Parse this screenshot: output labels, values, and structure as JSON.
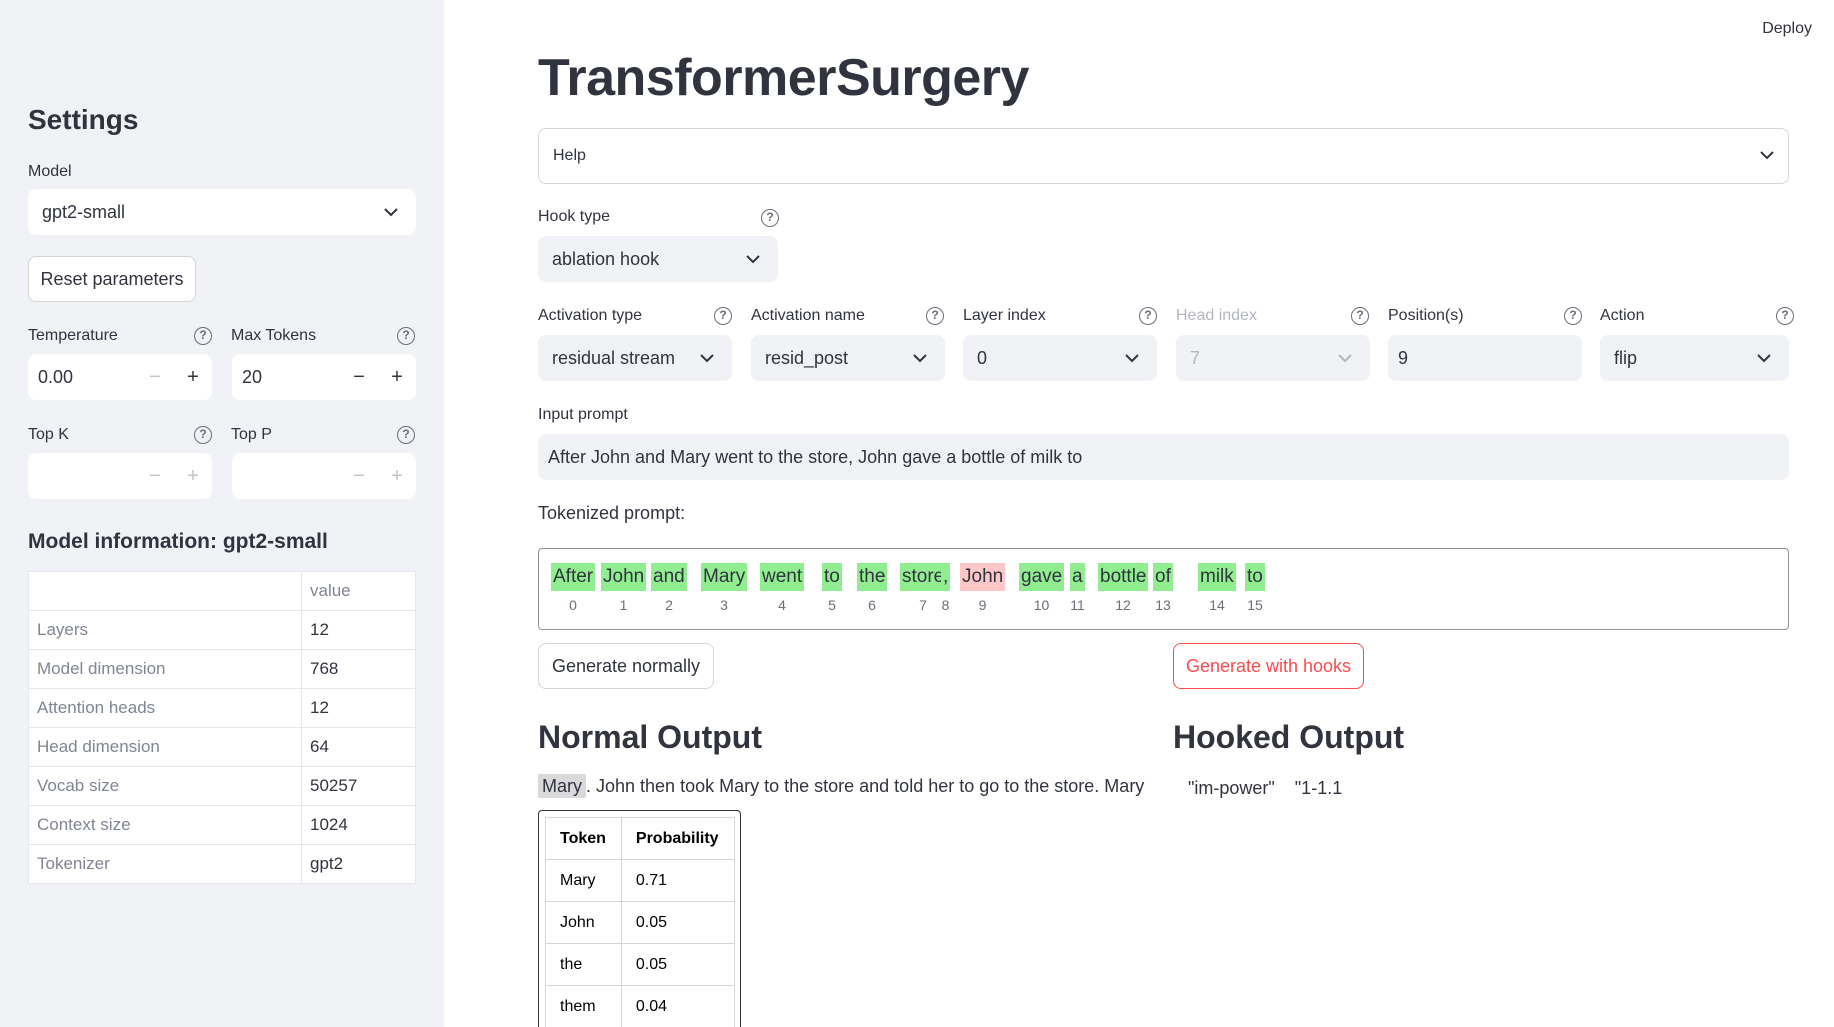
{
  "deploy_label": "Deploy",
  "sidebar": {
    "title": "Settings",
    "model_label": "Model",
    "model_value": "gpt2-small",
    "reset_label": "Reset parameters",
    "temperature": {
      "label": "Temperature",
      "value": "0.00"
    },
    "max_tokens": {
      "label": "Max Tokens",
      "value": "20"
    },
    "top_k": {
      "label": "Top K",
      "value": ""
    },
    "top_p": {
      "label": "Top P",
      "value": ""
    },
    "info_title": "Model information: gpt2-small",
    "info_header": [
      "",
      "value"
    ],
    "info_rows": [
      {
        "k": "Layers",
        "v": "12"
      },
      {
        "k": "Model dimension",
        "v": "768"
      },
      {
        "k": "Attention heads",
        "v": "12"
      },
      {
        "k": "Head dimension",
        "v": "64"
      },
      {
        "k": "Vocab size",
        "v": "50257"
      },
      {
        "k": "Context size",
        "v": "1024"
      },
      {
        "k": "Tokenizer",
        "v": "gpt2"
      }
    ]
  },
  "main": {
    "title": "TransformerSurgery",
    "help_label": "Help",
    "hook_type": {
      "label": "Hook type",
      "value": "ablation hook"
    },
    "activation_type": {
      "label": "Activation type",
      "value": "residual stream"
    },
    "activation_name": {
      "label": "Activation name",
      "value": "resid_post"
    },
    "layer_index": {
      "label": "Layer index",
      "value": "0"
    },
    "head_index": {
      "label": "Head index",
      "value": "7"
    },
    "positions": {
      "label": "Position(s)",
      "value": "9"
    },
    "action": {
      "label": "Action",
      "value": "flip"
    },
    "input_label": "Input prompt",
    "input_value": "After John and Mary went to the store, John gave a bottle of milk to",
    "tokenized_label": "Tokenized prompt:",
    "tokens": [
      {
        "text": "After",
        "idx": "0",
        "color": "green"
      },
      {
        "text": "John",
        "idx": "1",
        "color": "green"
      },
      {
        "text": "and",
        "idx": "2",
        "color": "green"
      },
      {
        "text": "Mary",
        "idx": "3",
        "color": "green"
      },
      {
        "text": "went",
        "idx": "4",
        "color": "green"
      },
      {
        "text": "to",
        "idx": "5",
        "color": "green"
      },
      {
        "text": "the",
        "idx": "6",
        "color": "green"
      },
      {
        "text": "store",
        "idx": "7",
        "color": "green"
      },
      {
        "text": ",",
        "idx": "8",
        "color": "green"
      },
      {
        "text": "John",
        "idx": "9",
        "color": "red"
      },
      {
        "text": "gave",
        "idx": "10",
        "color": "green"
      },
      {
        "text": "a",
        "idx": "11",
        "color": "green"
      },
      {
        "text": "bottle",
        "idx": "12",
        "color": "green"
      },
      {
        "text": "of",
        "idx": "13",
        "color": "green"
      },
      {
        "text": "milk",
        "idx": "14",
        "color": "green"
      },
      {
        "text": "to",
        "idx": "15",
        "color": "green"
      }
    ],
    "generate_normal_label": "Generate normally",
    "generate_hooks_label": "Generate with hooks",
    "normal_output_title": "Normal Output",
    "hooked_output_title": "Hooked Output",
    "normal_output_first": "Mary",
    "normal_output_rest": ". John then took Mary to the store and told her to go to the store. Mary",
    "hooked_output_text": "\"im-power\"    \"1-1.1",
    "prob_header": [
      "Token",
      "Probability"
    ],
    "prob_rows": [
      {
        "token": "Mary",
        "p": "0.71"
      },
      {
        "token": "John",
        "p": "0.05"
      },
      {
        "token": "the",
        "p": "0.05"
      },
      {
        "token": "them",
        "p": "0.04"
      }
    ]
  },
  "colors": {
    "accent_red": "#ff4b4b",
    "token_green": "#90ee90",
    "token_red": "#ffc8c8",
    "sidebar_bg": "#f0f2f6"
  }
}
